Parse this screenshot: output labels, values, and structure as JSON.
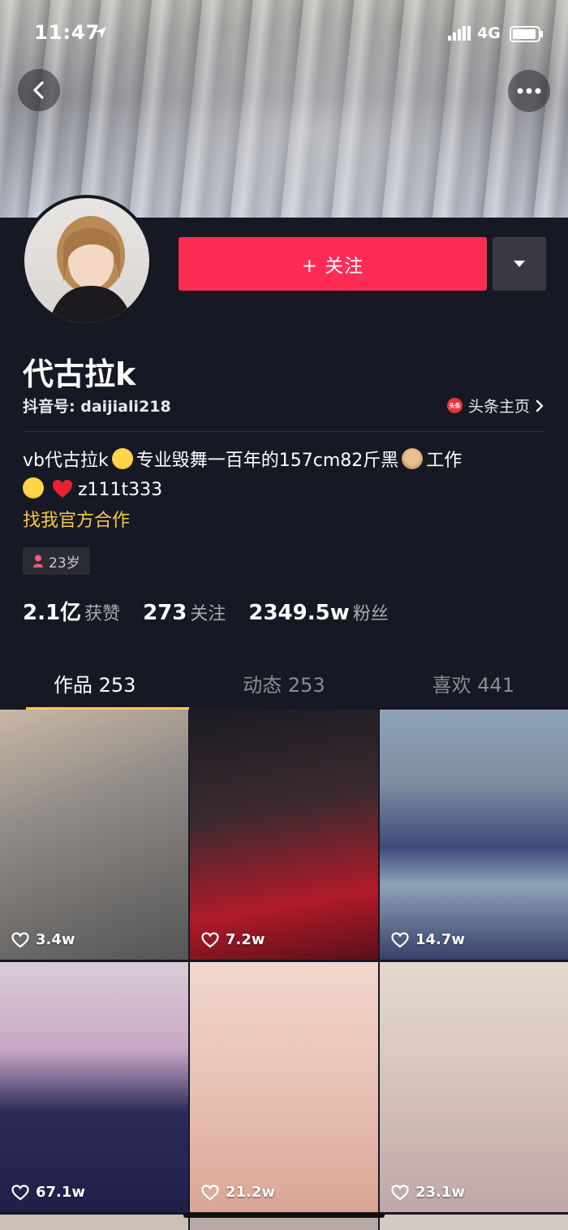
{
  "status": {
    "time": "11:47",
    "network": "4G"
  },
  "profile": {
    "nickname": "代古拉k",
    "account_id": "抖音号: daijiali218",
    "toutiao_link": "头条主页",
    "toutiao_badge": "头条",
    "bio_part1": "vb代古拉k",
    "bio_part2": "专业毁舞一百年的157cm82斤黑",
    "bio_part3": "工作",
    "bio_part4": "z111t333",
    "collab": "找我官方合作",
    "age": "23岁"
  },
  "actions": {
    "follow_label": "+ 关注"
  },
  "stats": [
    {
      "value": "2.1亿",
      "label": "获赞"
    },
    {
      "value": "273",
      "label": "关注"
    },
    {
      "value": "2349.5w",
      "label": "粉丝"
    }
  ],
  "tabs": [
    {
      "label": "作品 253",
      "active": true
    },
    {
      "label": "动态 253",
      "active": false
    },
    {
      "label": "喜欢 441",
      "active": false
    }
  ],
  "videos": [
    {
      "likes": "3.4w"
    },
    {
      "likes": "7.2w"
    },
    {
      "likes": "14.7w"
    },
    {
      "likes": "67.1w"
    },
    {
      "likes": "21.2w"
    },
    {
      "likes": "23.1w"
    }
  ],
  "colors": {
    "follow_button": "#fe2c55",
    "accent": "#f7c948",
    "background": "#161823"
  }
}
